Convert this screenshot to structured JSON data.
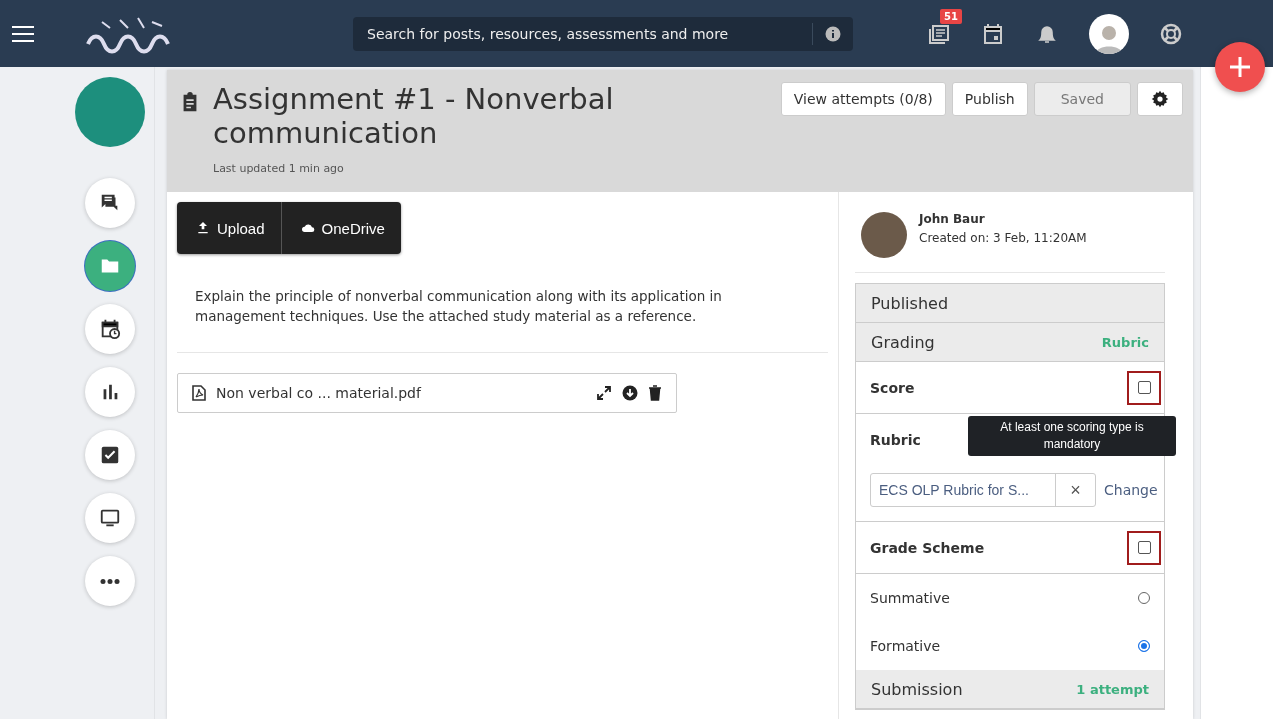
{
  "topbar": {
    "search_placeholder": "Search for posts, resources, assessments and more",
    "badge": "51"
  },
  "sidebar": {
    "items": [
      {
        "kind": "chat",
        "selected": false
      },
      {
        "kind": "folder",
        "selected": true
      },
      {
        "kind": "calendar",
        "selected": false
      },
      {
        "kind": "chart",
        "selected": false
      },
      {
        "kind": "check",
        "selected": false
      },
      {
        "kind": "screen",
        "selected": false
      },
      {
        "kind": "more",
        "selected": false
      }
    ]
  },
  "header": {
    "title": "Assignment #1 - Nonverbal communication",
    "updated": "Last updated 1 min ago",
    "buttons": [
      {
        "label": "View attempts (0/8)",
        "disabled": false
      },
      {
        "label": "Publish",
        "disabled": false
      },
      {
        "label": "Saved",
        "disabled": true
      }
    ]
  },
  "upload_buttons": [
    {
      "kind": "upload",
      "label": "Upload"
    },
    {
      "kind": "cloud",
      "label": "OneDrive"
    }
  ],
  "description": "Explain the principle of nonverbal communication along with its application in management techniques. Use the attached study material as a reference.",
  "attachment": {
    "name": "Non verbal co ... material.pdf"
  },
  "author": {
    "name": "John Baur",
    "created": "Created on: 3 Feb, 11:20AM"
  },
  "settings": {
    "published": "Published",
    "grading": {
      "label": "Grading",
      "value": "Rubric"
    },
    "score": {
      "label": "Score",
      "checked": false
    },
    "rubric": {
      "label": "Rubric",
      "value": "ECS OLP Rubric for S...",
      "change": "Change",
      "clear": "×",
      "tooltip": "At least one scoring type is mandatory"
    },
    "grade_scheme": {
      "label": "Grade Scheme",
      "checked": false
    },
    "options": [
      {
        "label": "Summative",
        "selected": false
      },
      {
        "label": "Formative",
        "selected": true
      }
    ],
    "submission": {
      "label": "Submission",
      "value": "1 attempt"
    }
  }
}
